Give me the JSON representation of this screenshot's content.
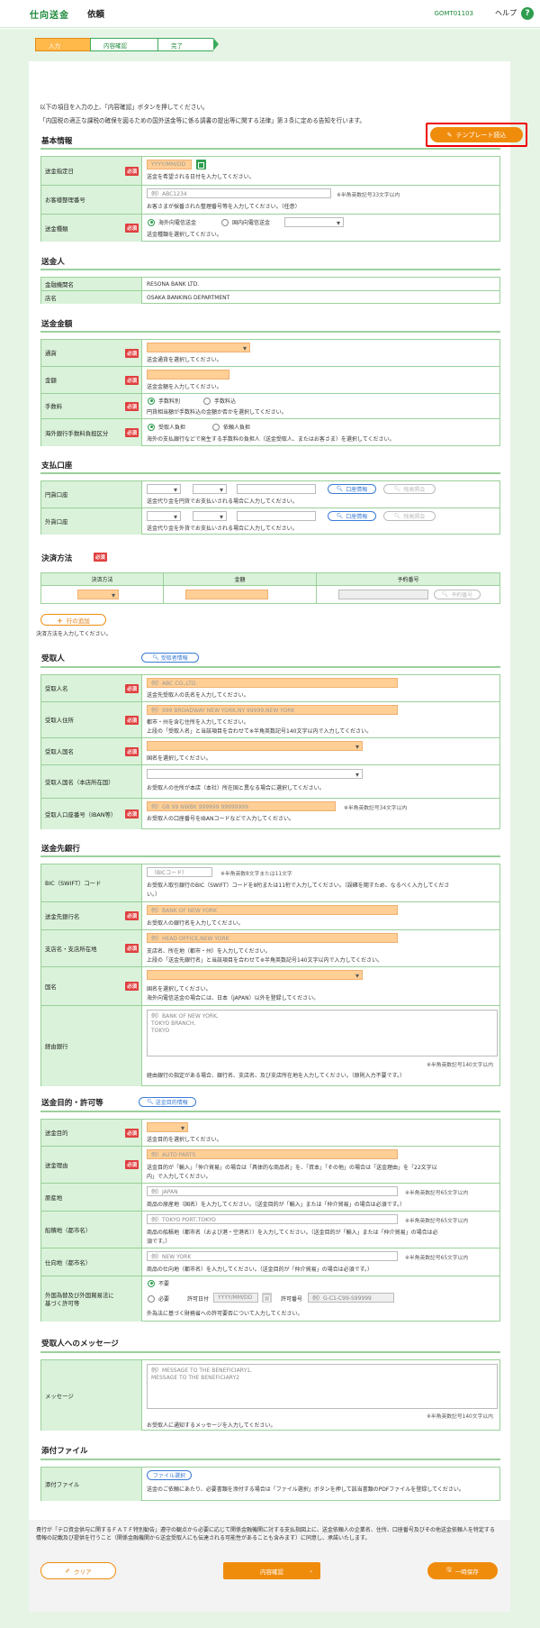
{
  "header": {
    "title": "仕向送金",
    "subtitle": "依頼",
    "screen_code": "GOMT01103",
    "help_label": "ヘルプ",
    "help_icon": "?"
  },
  "steps": [
    "入力",
    "内容確認",
    "完了"
  ],
  "intro": {
    "line1": "以下の項目を入力の上、「内容確認」ボタンを押してください。",
    "line2": "「内国税の適正な課税の確保を図るための国外送金等に係る調書の提出等に関する法律」第３条に定める告知を行います。",
    "template_button": "テンプレート読込"
  },
  "required_label": "必須",
  "basic": {
    "title": "基本情報",
    "date_label": "送金指定日",
    "date_placeholder": "YYYY/MM/DD",
    "date_help": "送金を希望される日付を入力してください。",
    "ref_label": "お客様整理番号",
    "ref_placeholder": "例）ABC1234",
    "ref_note": "※半角英数記号33文字以内",
    "ref_help": "お客さまが採番された整理番号等を入力してください。（任意）",
    "type_label": "送金種類",
    "type_opt1": "海外向電信送金",
    "type_opt2": "国内向電信送金",
    "type_help": "送金種類を選択してください。"
  },
  "sender": {
    "title": "送金人",
    "bank_label": "金融機関名",
    "bank_value": "RESONA BANK LTD.",
    "branch_label": "店名",
    "branch_value": "OSAKA BANKING DEPARTMENT"
  },
  "amount": {
    "title": "送金金額",
    "currency_label": "通貨",
    "currency_help": "送金通貨を選択してください。",
    "amount_label": "金額",
    "amount_help": "送金金額を入力してください。",
    "fee_label": "手数料",
    "fee_opt1": "手数料別",
    "fee_opt2": "手数料込",
    "fee_help": "円貨相当額が手数料込の金額か否かを選択してください。",
    "overseas_label": "海外銀行手数料負担区分",
    "overseas_opt1": "受取人負担",
    "overseas_opt2": "依頼人負担",
    "overseas_help": "海外の支払銀行などで発生する手数料の負担人（送金受取人、またはお客さま）を選択してください。"
  },
  "account": {
    "title": "支払口座",
    "yen_label": "円貨口座",
    "yen_help": "送金代り金を円貨でお支払いされる場合に入力してください。",
    "fx_label": "外貨口座",
    "fx_help": "送金代り金を外貨でお支払いされる場合に入力してください。",
    "lookup": "口座情報",
    "balance": "残高照会"
  },
  "settle": {
    "title": "決済方法",
    "col_method": "決済方法",
    "col_amount": "金額",
    "col_ref": "予約番号",
    "ref_button": "予約番号",
    "add_row": "行の追加",
    "help": "決済方法を入力してください。"
  },
  "payee": {
    "title": "受取人",
    "info_button": "受取者情報",
    "name_label": "受取人名",
    "name_placeholder": "例）ABC CO.,LTD.",
    "name_help": "送金先受取人の氏名を入力してください。",
    "addr_label": "受取人住所",
    "addr_placeholder": "例）999 BROADWAY NEW YORK,NY 99999,NEW YORK",
    "addr_help1": "都市・州を含む住所を入力してください。",
    "addr_help2": "上段の「受取人名」と当該項目を合わせて※半角英数記号140文字以内で入力してください。",
    "country_label": "受取人国名",
    "country_help": "国名を選択してください。",
    "hq_label": "受取人国名（本店所在国）",
    "hq_help": "お受取人の住所が本店（本社）所在国と異なる場合に選択してください。",
    "iban_label": "受取人口座番号（IBAN等）",
    "iban_placeholder": "例）GB 99 NWBK 999999 99999999",
    "iban_note": "※半角英数記号34文字以内",
    "iban_help": "お受取人の口座番号をIBANコードなどで入力してください。"
  },
  "bank": {
    "title": "送金先銀行",
    "bic_label": "BIC（SWIFT）コード",
    "bic_placeholder": "（BICコード）",
    "bic_note": "※半角英数8文字または11文字",
    "bic_help1": "お受取人取引銀行のBIC（SWIFT）コードを8桁または11桁で入力してください。（誤確を期すため、なるべく入力してくださ",
    "bic_help2": "い。）",
    "name_label": "送金先銀行名",
    "name_placeholder": "例）BANK OF NEW YORK",
    "name_help": "お受取人の銀行名を入力してください。",
    "branch_label": "支店名・支店所在地",
    "branch_placeholder": "例）HEAD OFFICE,NEW YORK",
    "branch_help1": "支店名、所在地（都市・州）を入力してください。",
    "branch_help2": "上段の「送金先銀行名」と当該項目を合わせて※半角英数記号140文字以内で入力してください。",
    "country_label": "国名",
    "country_help1": "国名を選択してください。",
    "country_help2": "海外向電信送金の場合には、日本（JAPAN）以外を登録してください。",
    "via_label": "経由銀行",
    "via_placeholder": "例）BANK OF NEW YORK,\nTOKYO BRANCH,\nTOKYO",
    "via_note": "※半角英数記号140文字以内",
    "via_help": "経由銀行の指定がある場合、銀行名、支店名、及び支店所在地を入力してください。（原則入力不要です。）"
  },
  "purpose": {
    "title": "送金目的・許可等",
    "info_button": "送金目的情報",
    "purpose_label": "送金目的",
    "purpose_help": "送金目的を選択してください。",
    "reason_label": "送金理由",
    "reason_placeholder": "例）AUTO PARTS",
    "reason_help1": "送金目的が「輸入」「仲介貿易」の場合は「具体的な商品名」を、「資本」「その他」の場合は「送金理由」を「22文字以",
    "reason_help2": "内」で入力してください。",
    "origin_label": "原産地",
    "origin_placeholder": "例）JAPAN",
    "origin_note": "※半角英数記号65文字以内",
    "origin_help": "商品の原産地（国名）を入力してください。（送金目的が「輸入」または「仲介貿易」の場合は必須です。）",
    "ship_label": "船積地（都市名）",
    "ship_placeholder": "例）TOKYO PORT,TOKYO",
    "ship_note": "※半角英数記号65文字以内",
    "ship_help1": "商品の船積地（都市名（および港・空港名））を入力してください。（送金目的が「輸入」または「仲介貿易」の場合は必",
    "ship_help2": "須です。）",
    "dest_label": "仕向地（都市名）",
    "dest_placeholder": "例）NEW YORK",
    "dest_note": "※半角英数記号65文字以内",
    "dest_help": "商品の仕向地（都市名）を入力してください。（送金目的が「仲介貿易」の場合は必須です。）",
    "permit_label1": "外国為替及び外国貿易法に",
    "permit_label2": "基づく許可等",
    "permit_opt1": "不要",
    "permit_opt2": "必要",
    "permit_date_label": "許可日付",
    "permit_date_placeholder": "YYYY/MM/DD",
    "permit_no_label": "許可番号",
    "permit_no_placeholder": "例）G-C1-C99-S99999",
    "permit_help": "外為法に基づく財務省への許可要否について入力してください。"
  },
  "message": {
    "title": "受取人へのメッセージ",
    "label": "メッセージ",
    "placeholder": "例）MESSAGE TO THE BENEFICIARY1,\nMESSAGE TO THE BENEFICIARY2",
    "note": "※半角英数記号140文字以内",
    "help": "お受取人に通知するメッセージを入力してください。"
  },
  "attach": {
    "title": "添付ファイル",
    "label": "添付ファイル",
    "button": "ファイル選択",
    "help": "送金のご依頼にあたり、必要書類を添付する場合は「ファイル選択」ボタンを押して該当書類のPDFファイルを登録してください。"
  },
  "footer": {
    "notice1": "貴行が「テロ資金供与に関するＦＡＴＦ特別勧告」遵守の観点から必要に応じて関係金融機関に対する支払指図上に、送金依頼人の企業名、住所、",
    "notice2": "口座番号及びその他送金依頼人を特定する情報の記載及び提供を行うこと（関係金融機関から送金受取人にも伝達される可能性があることも含みます）に同意し、承諾いたします。",
    "clear": "クリア",
    "confirm": "内容確認",
    "save": "一時保存"
  }
}
